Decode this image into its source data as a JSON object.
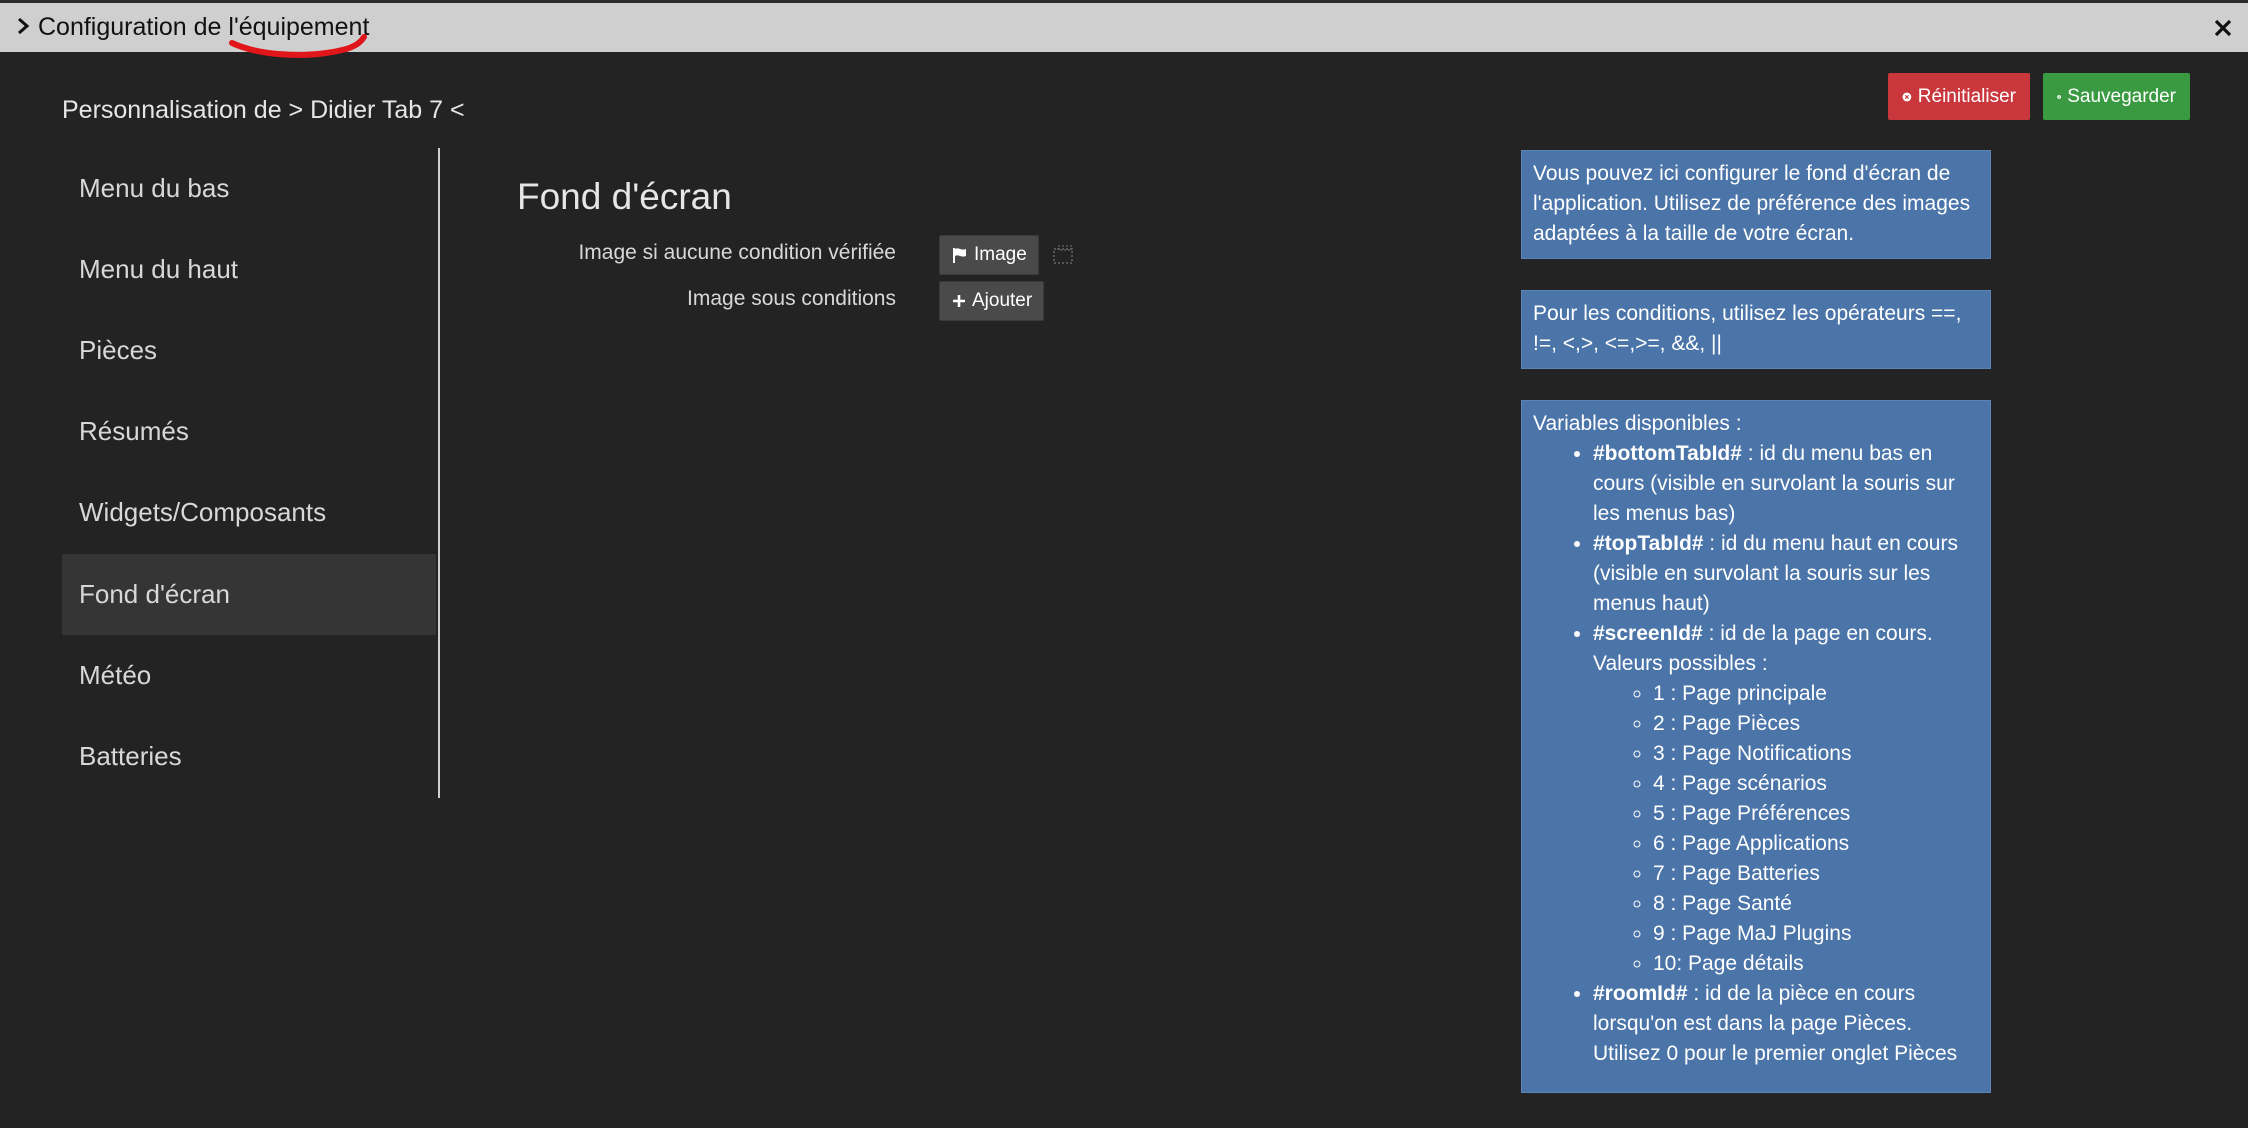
{
  "window": {
    "title": "Configuration de l'équipement"
  },
  "toolbar": {
    "reset_label": "Réinitialiser",
    "save_label": "Sauvegarder"
  },
  "breadcrumb": "Personnalisation de > Didier Tab 7 <",
  "sidebar": {
    "items": [
      {
        "label": "Menu du bas"
      },
      {
        "label": "Menu du haut"
      },
      {
        "label": "Pièces"
      },
      {
        "label": "Résumés"
      },
      {
        "label": "Widgets/Composants"
      },
      {
        "label": "Fond d'écran"
      },
      {
        "label": "Météo"
      },
      {
        "label": "Batteries"
      }
    ],
    "active_index": 5
  },
  "main": {
    "section_title": "Fond d'écran",
    "rows": [
      {
        "label": "Image si aucune condition vérifiée",
        "button": "Image"
      },
      {
        "label": "Image sous conditions",
        "button": "Ajouter"
      }
    ]
  },
  "help": {
    "box1": "Vous pouvez ici configurer le fond d'écran de l'application. Utilisez de préférence des images adaptées à la taille de votre écran.",
    "box2": "Pour les conditions, utilisez les opérateurs ==, !=, <,>, <=,>=, &&, ||",
    "variables_title": "Variables disponibles :",
    "variables": [
      {
        "name": "#bottomTabId#",
        "desc": " : id du menu bas en cours (visible en survolant la souris sur les menus bas)"
      },
      {
        "name": "#topTabId#",
        "desc": " : id du menu haut en cours (visible en survolant la souris sur les menus haut)"
      },
      {
        "name": "#screenId#",
        "desc": " : id de la page en cours. Valeurs possibles :"
      },
      {
        "name": "#roomId#",
        "desc": " : id de la pièce en cours lorsqu'on est dans la page Pièces. Utilisez 0 pour le premier onglet Pièces"
      }
    ],
    "screen_values": [
      "1 : Page principale",
      "2 : Page Pièces",
      "3 : Page Notifications",
      "4 : Page scénarios",
      "5 : Page Préférences",
      "6 : Page Applications",
      "7 : Page Batteries",
      "8 : Page Santé",
      "9 : Page MaJ Plugins",
      "10: Page détails"
    ]
  },
  "colors": {
    "background": "#232323",
    "titlebar": "#cfcfcf",
    "reset": "#c9373d",
    "save": "#3a9a41",
    "info": "#4b74a8",
    "annotation": "#e0161b"
  }
}
